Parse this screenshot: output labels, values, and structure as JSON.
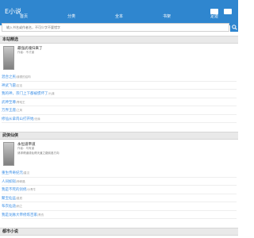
{
  "header": {
    "logo": "E小说"
  },
  "nav": {
    "items": [
      "首页",
      "分类",
      "全本",
      "书架",
      "足迹"
    ]
  },
  "search": {
    "placeholder": "输入书名或作者名，不可少字不要错字"
  },
  "sections": [
    {
      "title": "本站精选",
      "featured": {
        "title": "最强武魂归来了",
        "meta": "作者：不才道",
        "desc": ""
      },
      "items": [
        {
          "title": "混合之民",
          "author": "/道德的结构"
        },
        {
          "title": "神武飞雷",
          "author": "/定法"
        },
        {
          "title": "我的神，宗门上下都被惯坏了",
          "author": "/九道"
        },
        {
          "title": "武神至尊",
          "author": "/青蛙王"
        },
        {
          "title": "万界王座",
          "author": "/之风"
        },
        {
          "title": "修仙从拿肉山打开始",
          "author": "/无缘"
        }
      ]
    },
    {
      "title": "武侠仙侠",
      "featured": {
        "title": "永恒道帝道",
        "meta": "作者：乌有道",
        "desc": "请求得道成仙得天道之路前各方向"
      },
      "items": [
        {
          "title": "重生传奇纪元",
          "author": "/星汉"
        },
        {
          "title": "人间如狱",
          "author": "/神奇路"
        },
        {
          "title": "我是不死的剑修",
          "author": "/小青牛"
        },
        {
          "title": "聚宝仙盆",
          "author": "/星辰"
        },
        {
          "title": "布衣仙途",
          "author": "/雨之"
        },
        {
          "title": "我是龙脉大帝修炼百家",
          "author": "/青衣"
        }
      ]
    },
    {
      "title": "都市小说"
    }
  ]
}
